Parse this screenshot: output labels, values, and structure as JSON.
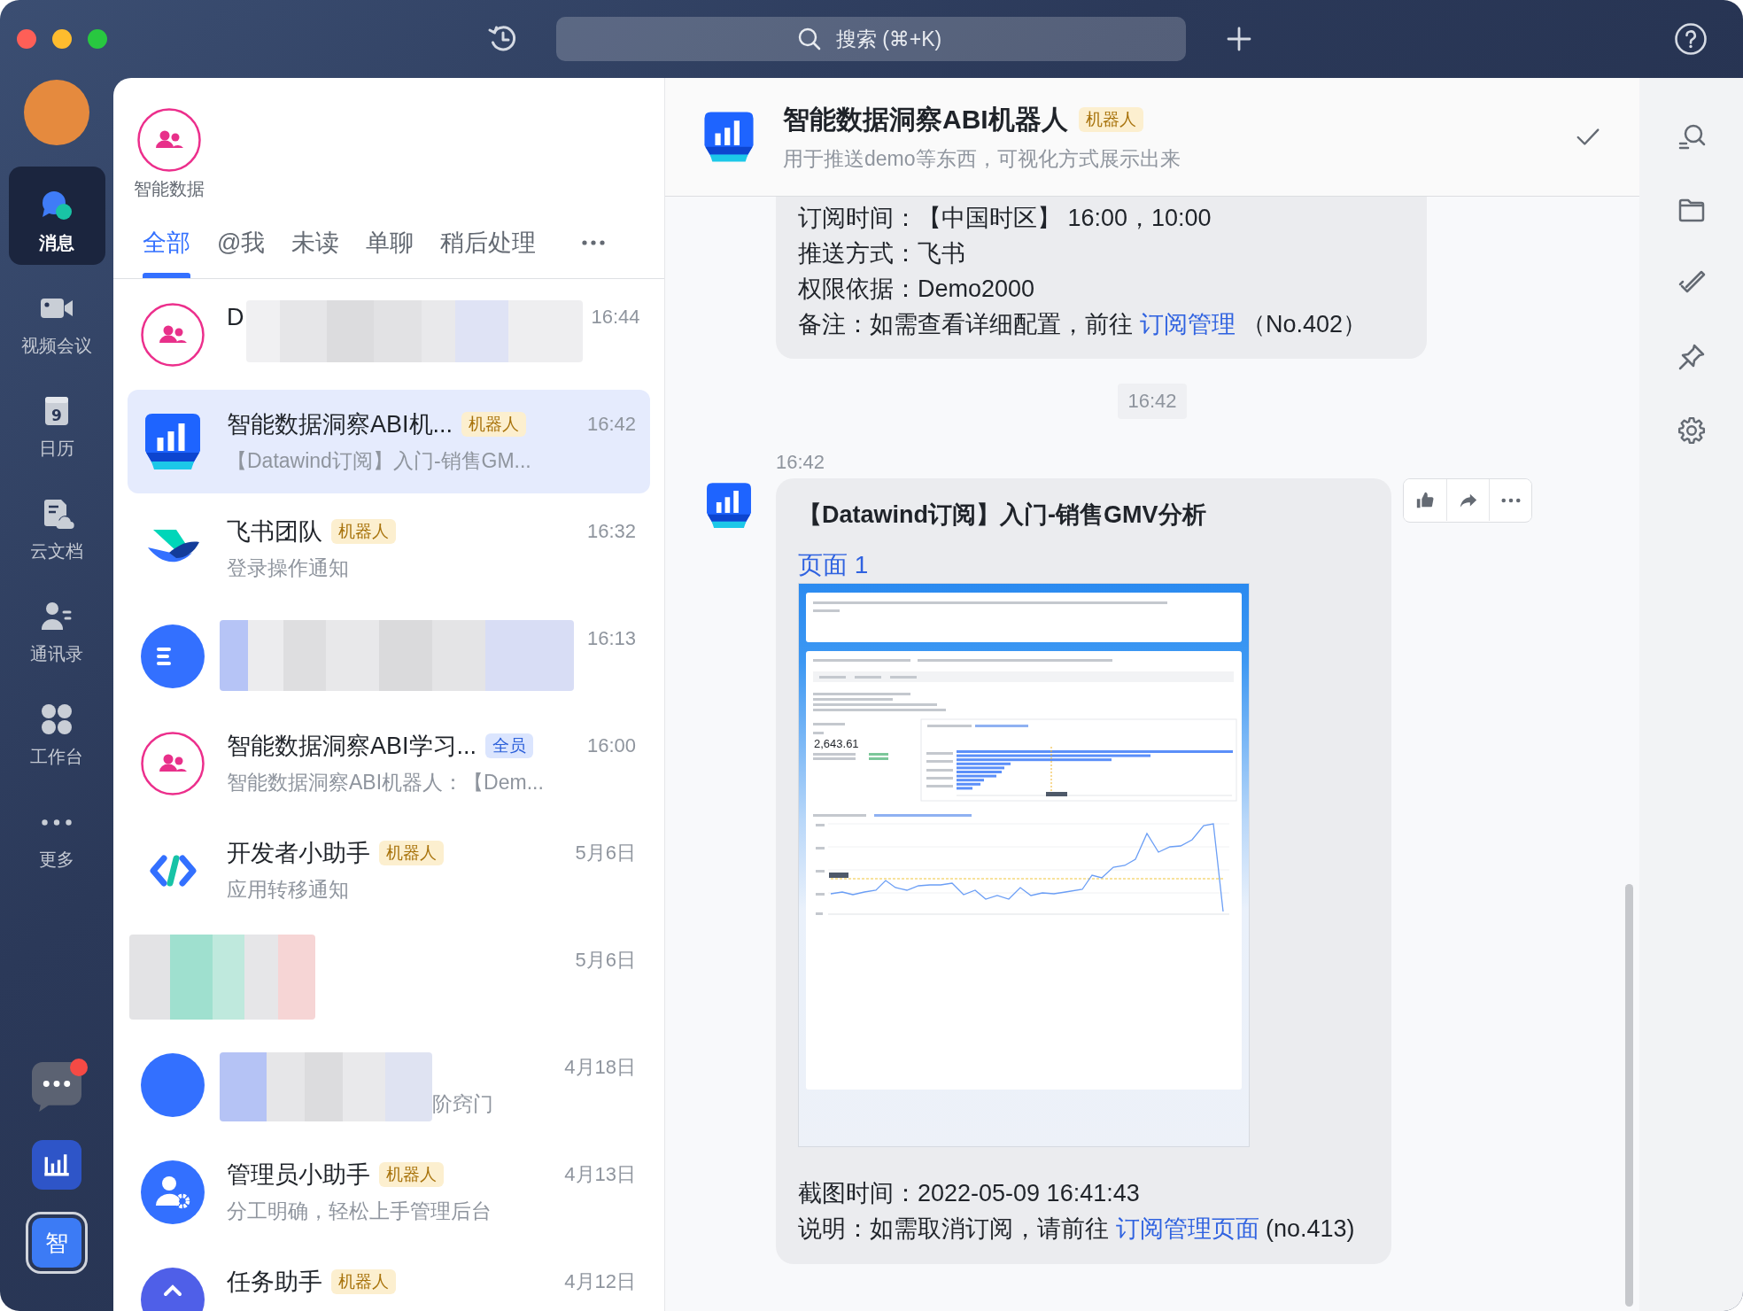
{
  "toolbar": {
    "search": {
      "placeholder": "搜索 (⌘+K)"
    }
  },
  "nav": {
    "items": [
      {
        "label": "消息",
        "selected": true
      },
      {
        "label": "视频会议",
        "selected": false
      },
      {
        "label": "日历",
        "selected": false,
        "icon_text": "9"
      },
      {
        "label": "云文档",
        "selected": false
      },
      {
        "label": "通讯录",
        "selected": false
      },
      {
        "label": "工作台",
        "selected": false
      },
      {
        "label": "更多",
        "selected": false
      }
    ],
    "dock": [
      {
        "kind": "chat",
        "unread": true,
        "selected": false
      },
      {
        "kind": "chart",
        "unread": false,
        "selected": false
      },
      {
        "kind": "text",
        "label": "智",
        "unread": false,
        "selected": true
      }
    ]
  },
  "pinned": [
    {
      "label": "智能数据"
    }
  ],
  "filter_tabs": [
    {
      "label": "全部",
      "selected": true
    },
    {
      "label": "@我",
      "selected": false
    },
    {
      "label": "未读",
      "selected": false
    },
    {
      "label": "单聊",
      "selected": false
    },
    {
      "label": "稍后处理",
      "selected": false
    }
  ],
  "chats": [
    {
      "kind": "redacted",
      "name": "D",
      "time": "16:44",
      "selected": false
    },
    {
      "kind": "chat",
      "name": "智能数据洞察ABI机...",
      "tag": {
        "label": "机器人",
        "kind": "bot"
      },
      "time": "16:42",
      "preview": "【Datawind订阅】入门-销售GM...",
      "selected": true
    },
    {
      "kind": "chat",
      "name": "飞书团队",
      "tag": {
        "label": "机器人",
        "kind": "bot"
      },
      "time": "16:32",
      "preview": "登录操作通知",
      "selected": false
    },
    {
      "kind": "redacted",
      "time": "16:13",
      "selected": false
    },
    {
      "kind": "chat",
      "name": "智能数据洞察ABI学习...",
      "tag": {
        "label": "全员",
        "kind": "all"
      },
      "time": "16:00",
      "preview": "智能数据洞察ABI机器人：【Dem...",
      "selected": false
    },
    {
      "kind": "chat",
      "name": "开发者小助手",
      "tag": {
        "label": "机器人",
        "kind": "bot"
      },
      "time": "5月6日",
      "preview": "应用转移通知",
      "selected": false
    },
    {
      "kind": "redacted",
      "time": "5月6日",
      "selected": false
    },
    {
      "kind": "redacted",
      "time": "4月18日",
      "preview": "阶窍门",
      "selected": false
    },
    {
      "kind": "chat",
      "name": "管理员小助手",
      "tag": {
        "label": "机器人",
        "kind": "bot"
      },
      "time": "4月13日",
      "preview": "分工明确，轻松上手管理后台",
      "selected": false
    },
    {
      "kind": "chat",
      "name": "任务助手",
      "tag": {
        "label": "机器人",
        "kind": "bot"
      },
      "time": "4月12日",
      "selected": false
    }
  ],
  "conversation": {
    "header": {
      "title": "智能数据洞察ABI机器人",
      "tag": {
        "label": "机器人",
        "kind": "bot"
      },
      "subtitle": "用于推送demo等东西，可视化方式展示出来"
    },
    "messages": [
      {
        "kind": "card_tail",
        "lines": [
          {
            "text": "订阅时间：【中国时区】 16:00，10:00"
          },
          {
            "text": "推送方式：飞书"
          },
          {
            "text": "权限依据：Demo2000"
          },
          {
            "text": "备注：如需查看详细配置，前往 ",
            "link": "订阅管理",
            "suffix": " （No.402）"
          }
        ]
      },
      {
        "kind": "time_divider",
        "text": "16:42"
      },
      {
        "kind": "card",
        "time": "16:42",
        "title": "【Datawind订阅】入门-销售GMV分析",
        "page_link": "页面 1",
        "screenshot": {
          "metric": "2,643.61"
        },
        "lines": [
          {
            "text": "截图时间：2022-05-09 16:41:43"
          },
          {
            "text": "说明：如需取消订阅，请前往 ",
            "link": "订阅管理页面",
            "suffix": " (no.413)"
          }
        ]
      }
    ]
  }
}
